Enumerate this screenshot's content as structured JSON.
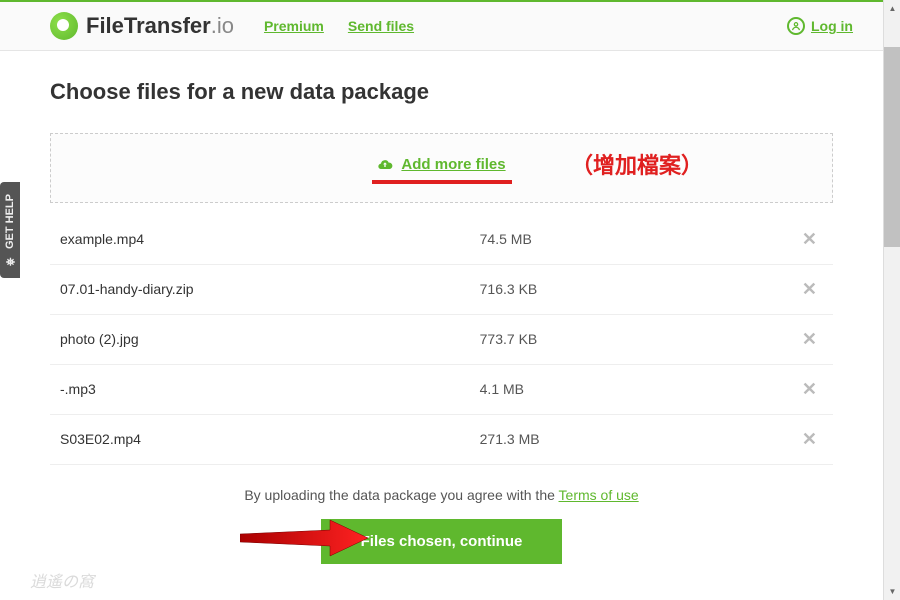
{
  "brand": {
    "name_main": "FileTransfer",
    "name_suffix": ".io"
  },
  "nav": {
    "premium": "Premium",
    "send_files": "Send files",
    "login": "Log in"
  },
  "page_title": "Choose files for a new data package",
  "dropzone": {
    "add_more": "Add more files",
    "annotation_cn": "（增加檔案）"
  },
  "files": [
    {
      "name": "example.mp4",
      "size": "74.5 MB"
    },
    {
      "name": "07.01-handy-diary.zip",
      "size": "716.3 KB"
    },
    {
      "name": "photo (2).jpg",
      "size": "773.7 KB"
    },
    {
      "name": "-.mp3",
      "size": "4.1 MB"
    },
    {
      "name": "S03E02.mp4",
      "size": "271.3 MB"
    }
  ],
  "footer": {
    "terms_prefix": "By uploading the data package you agree with the ",
    "terms_link": "Terms of use",
    "continue": "Files chosen, continue"
  },
  "help_tab": "GET HELP",
  "colors": {
    "accent": "#5fb82e",
    "annotation": "#e02020"
  }
}
